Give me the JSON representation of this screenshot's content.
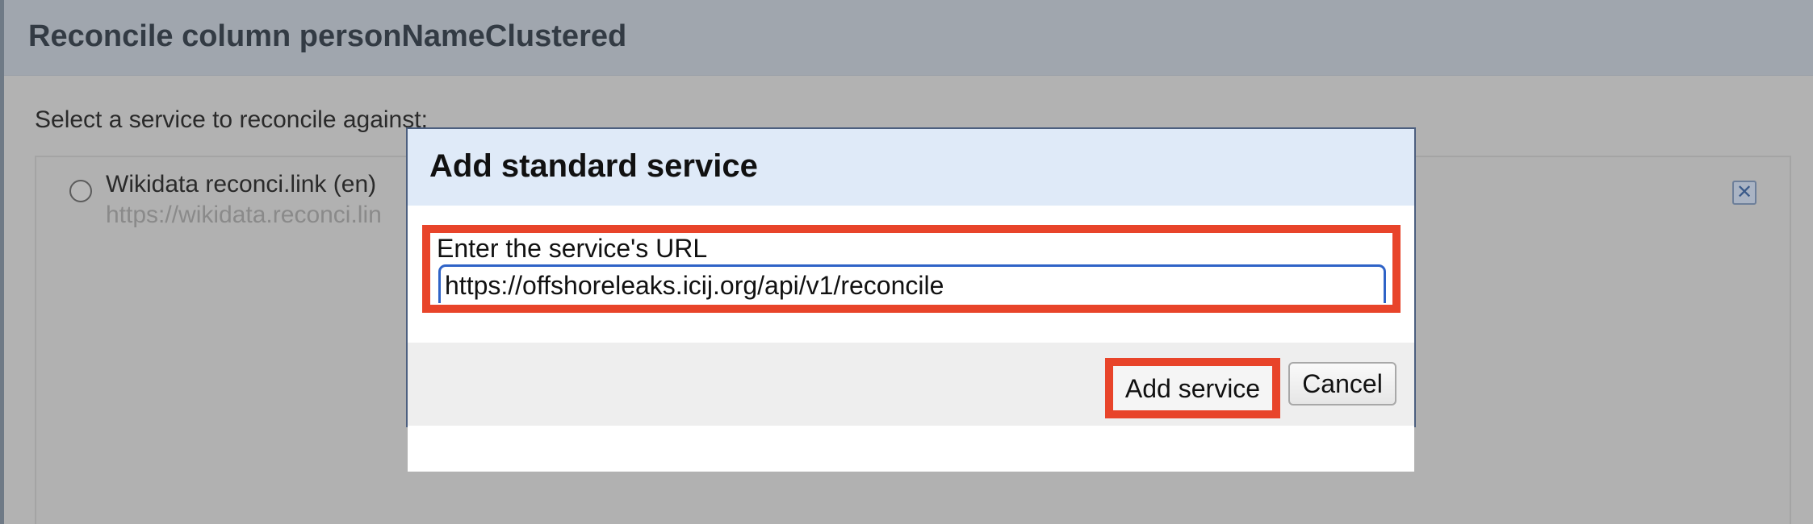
{
  "dialog": {
    "title": "Reconcile column personNameClustered",
    "prompt": "Select a service to reconcile against:",
    "services": [
      {
        "name": "Wikidata reconci.link (en)",
        "url": "https://wikidata.reconci.lin"
      }
    ],
    "remove_icon": "close-x-icon"
  },
  "modal": {
    "title": "Add standard service",
    "url_label": "Enter the service's URL",
    "url_value": "https://offshoreleaks.icij.org/api/v1/reconcile",
    "add_label": "Add service",
    "cancel_label": "Cancel"
  },
  "colors": {
    "highlight": "#e8442a",
    "input_focus": "#2f63c7",
    "modal_header": "#dfeaf8"
  }
}
